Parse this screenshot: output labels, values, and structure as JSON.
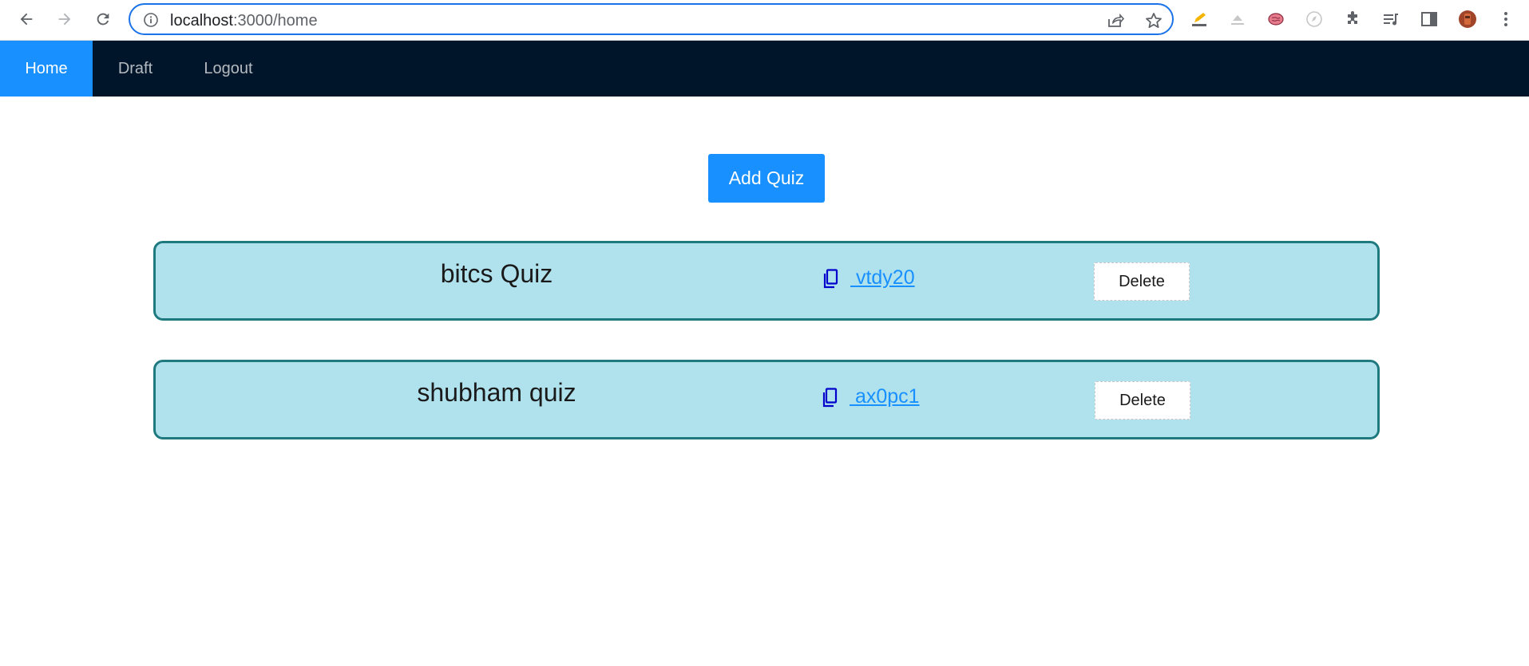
{
  "browser": {
    "url_host": "localhost",
    "url_rest": ":3000/home"
  },
  "nav": {
    "items": [
      {
        "label": "Home",
        "active": true
      },
      {
        "label": "Draft",
        "active": false
      },
      {
        "label": "Logout",
        "active": false
      }
    ]
  },
  "main": {
    "add_quiz_label": "Add Quiz",
    "quizzes": [
      {
        "title": "bitcs Quiz",
        "code": " vtdy20",
        "delete_label": "Delete"
      },
      {
        "title": "shubham quiz",
        "code": " ax0pc1",
        "delete_label": "Delete"
      }
    ]
  },
  "colors": {
    "nav_bg": "#001529",
    "accent": "#1890ff",
    "card_bg": "#b0e2ee",
    "card_border": "#1e7a7e"
  }
}
